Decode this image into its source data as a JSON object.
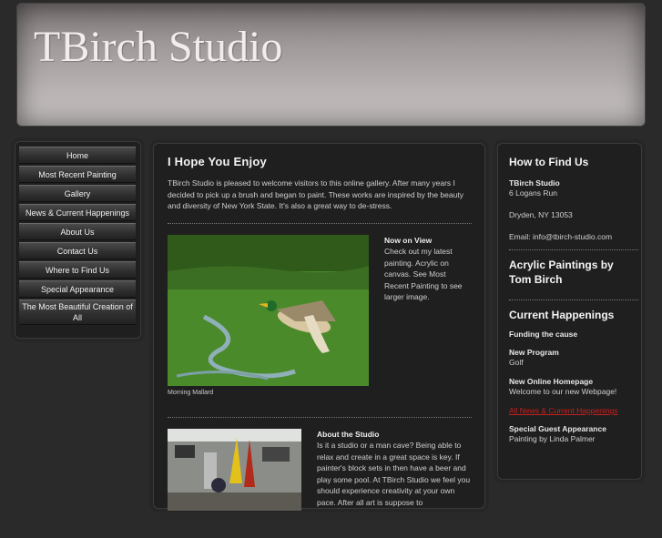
{
  "header": {
    "title": "TBirch Studio"
  },
  "nav": {
    "items": [
      "Home",
      "Most Recent Painting",
      "Gallery",
      "News & Current Happenings",
      "About Us",
      "Contact Us",
      "Where to Find Us",
      "Special Appearance",
      "The Most Beautiful Creation of All"
    ]
  },
  "main": {
    "heading": "I Hope You Enjoy",
    "intro": "TBirch Studio is pleased to welcome visitors to this online gallery. After many years I decided to pick up a brush and began to paint. These works are inspired by the beauty and diversity of New York State. It's also a great way to de-stress.",
    "feature": {
      "caption": "Morning Mallard",
      "title": "Now on View",
      "text": "Check out my latest painting. Acrylic on canvas. See Most Recent Painting to see larger image."
    },
    "about": {
      "title": "About the Studio",
      "text": "Is it a studio or a man cave? Being able to relax and create in a great space is key. If painter's block sets in then have a beer and play some pool. At TBirch Studio we feel you should experience creativity at your own pace. After all art is suppose to"
    }
  },
  "sidebar": {
    "find_heading": "How to Find Us",
    "studio_name": "TBirch Studio",
    "address1": "6 Logans Run",
    "address2": "Dryden, NY 13053",
    "email": "Email: info@tbirch-studio.com",
    "acrylic_heading": "Acrylic Paintings by Tom Birch",
    "happenings_heading": "Current Happenings",
    "happenings": [
      {
        "title": "Funding the cause",
        "text": ""
      },
      {
        "title": "New Program",
        "text": "Golf"
      },
      {
        "title": "New Online Homepage",
        "text": "Welcome to our new Webpage!"
      }
    ],
    "all_news_link": "All News & Current Happenings",
    "special_title": "Special Guest Appearance",
    "special_text": "Painting by Linda Palmer"
  },
  "colors": {
    "background": "#2a2a2a",
    "panel": "#1f1f1f",
    "link_red": "#c62020"
  }
}
